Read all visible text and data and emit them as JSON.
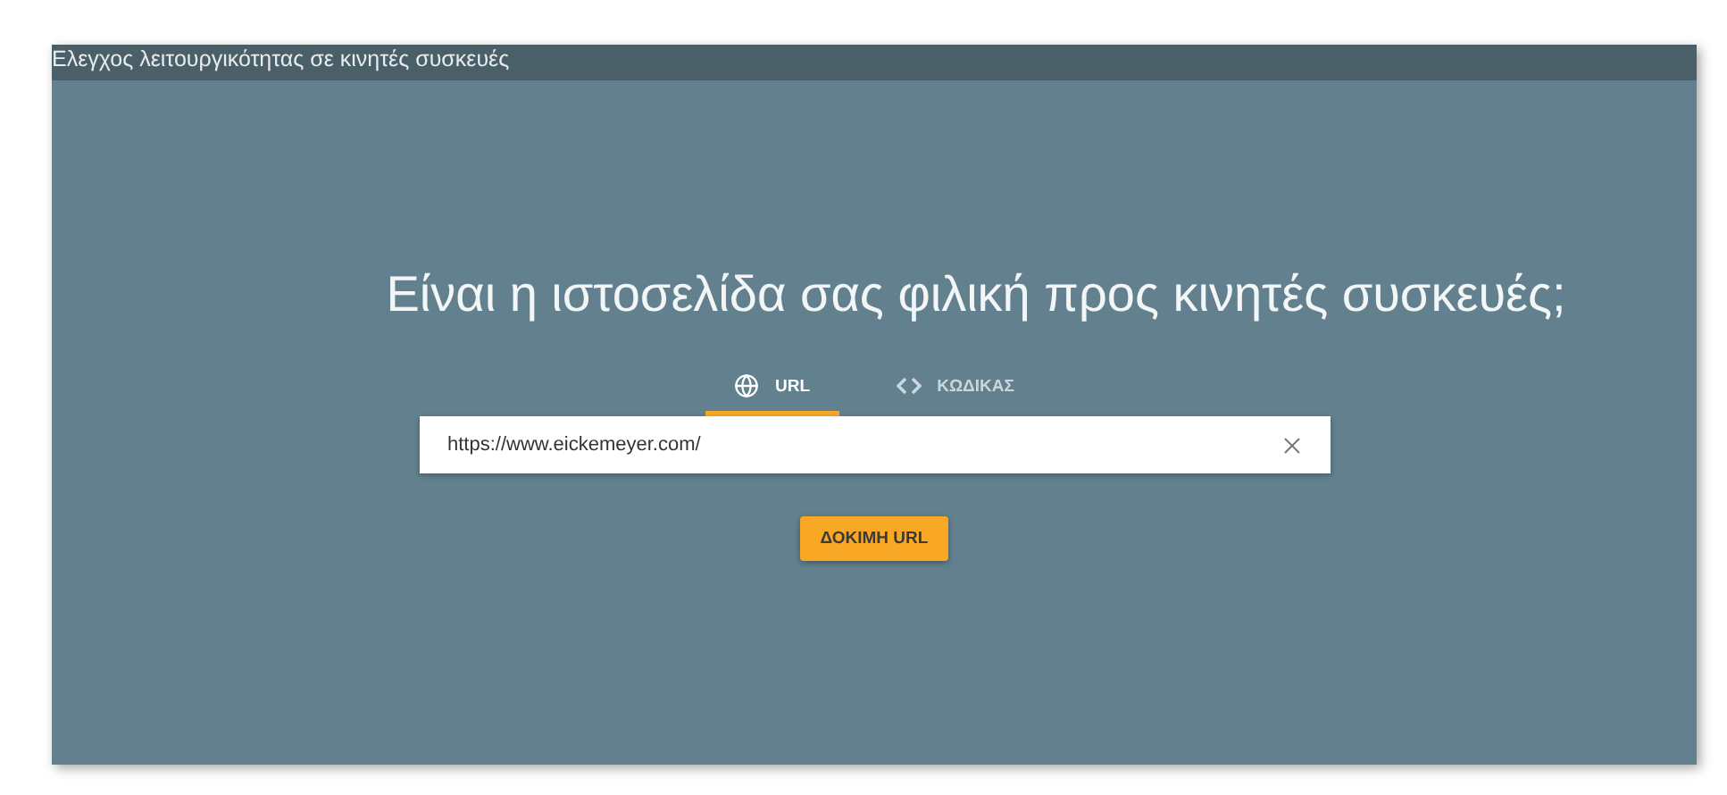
{
  "header": {
    "title": "Ελεγχος λειτουργικότητας σε κινητές συσκευές"
  },
  "heading": "Είναι η ιστοσελίδα σας φιλική προς κινητές συσκευές;",
  "tabs": [
    {
      "kind": "url",
      "label": "URL",
      "selected": true
    },
    {
      "kind": "code",
      "label": "ΚΩΔΙΚΑΣ",
      "selected": false
    }
  ],
  "url_field": {
    "value": "https://www.eickemeyer.com/"
  },
  "submit_button": "ΔΟΚΙΜΗ URL"
}
